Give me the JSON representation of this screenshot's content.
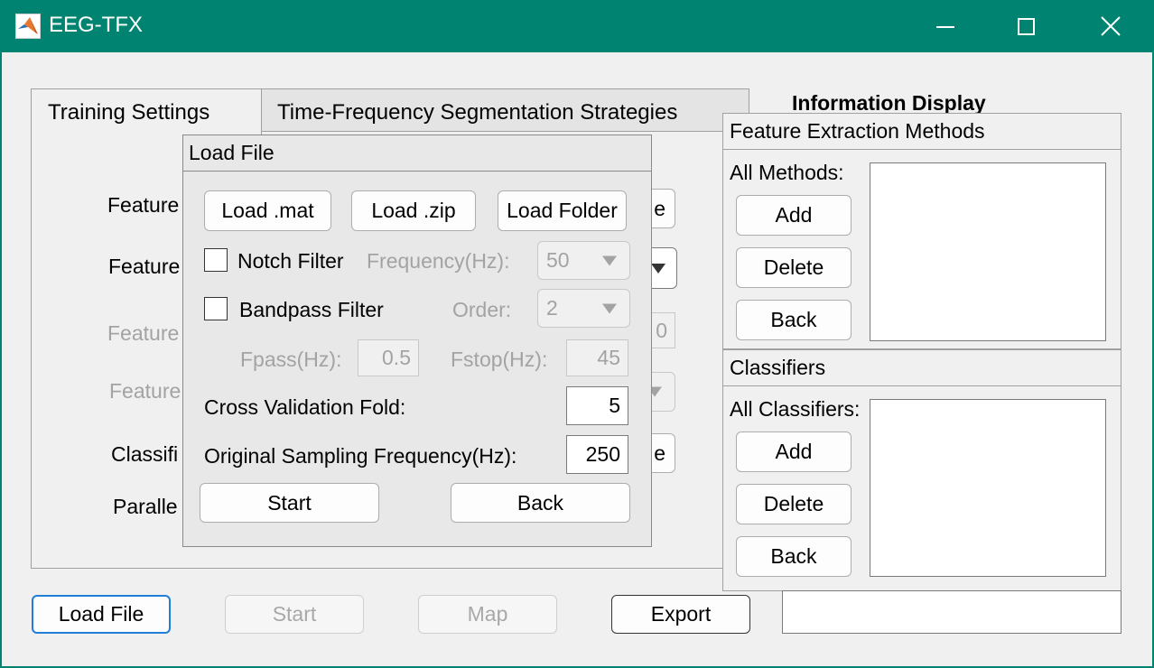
{
  "window": {
    "title": "EEG-TFX",
    "accent_color": "#008370",
    "controls": {
      "minimize": "minimize-icon",
      "maximize": "maximize-icon",
      "close": "close-icon"
    }
  },
  "tabs": [
    {
      "label": "Training Settings",
      "active": true
    },
    {
      "label": "Time-Frequency Segmentation Strategies",
      "active": false
    }
  ],
  "background_form": {
    "labels": [
      "Feature",
      "Feature",
      "Feature",
      "Feature",
      "Classifi",
      "Paralle"
    ],
    "fragments": {
      "button_top": "e",
      "field_value": "0",
      "button_mid": "e"
    }
  },
  "load_dialog": {
    "title": "Load File",
    "load_mat": "Load .mat",
    "load_zip": "Load .zip",
    "load_folder": "Load Folder",
    "notch_label": "Notch Filter",
    "notch_checked": false,
    "frequency_label": "Frequency(Hz):",
    "frequency_value": "50",
    "bandpass_label": "Bandpass Filter",
    "bandpass_checked": false,
    "order_label": "Order:",
    "order_value": "2",
    "fpass_label": "Fpass(Hz):",
    "fpass_value": "0.5",
    "fstop_label": "Fstop(Hz):",
    "fstop_value": "45",
    "cv_label": "Cross Validation Fold:",
    "cv_value": "5",
    "sampling_label": "Original Sampling Frequency(Hz):",
    "sampling_value": "250",
    "start": "Start",
    "back": "Back"
  },
  "info_display": {
    "heading": "Information Display",
    "feature_panel": {
      "title": "Feature Extraction Methods",
      "list_label": "All Methods:",
      "add": "Add",
      "delete": "Delete",
      "back": "Back"
    },
    "classifier_panel": {
      "title": "Classifiers",
      "list_label": "All Classifiers:",
      "add": "Add",
      "delete": "Delete",
      "back": "Back"
    }
  },
  "bottom_bar": {
    "load_file": "Load File",
    "start": "Start",
    "map": "Map",
    "export": "Export"
  }
}
